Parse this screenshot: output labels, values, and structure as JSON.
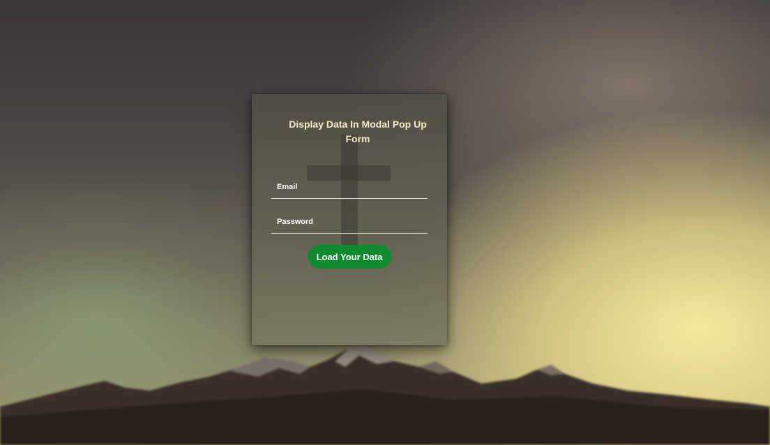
{
  "modal": {
    "title": "Display Data In Modal Pop Up Form",
    "email_label": "Email",
    "password_label": "Password",
    "submit_label": "Load Your Data"
  },
  "colors": {
    "button": "#0e8a2f",
    "title_text": "#f3ecc8"
  }
}
